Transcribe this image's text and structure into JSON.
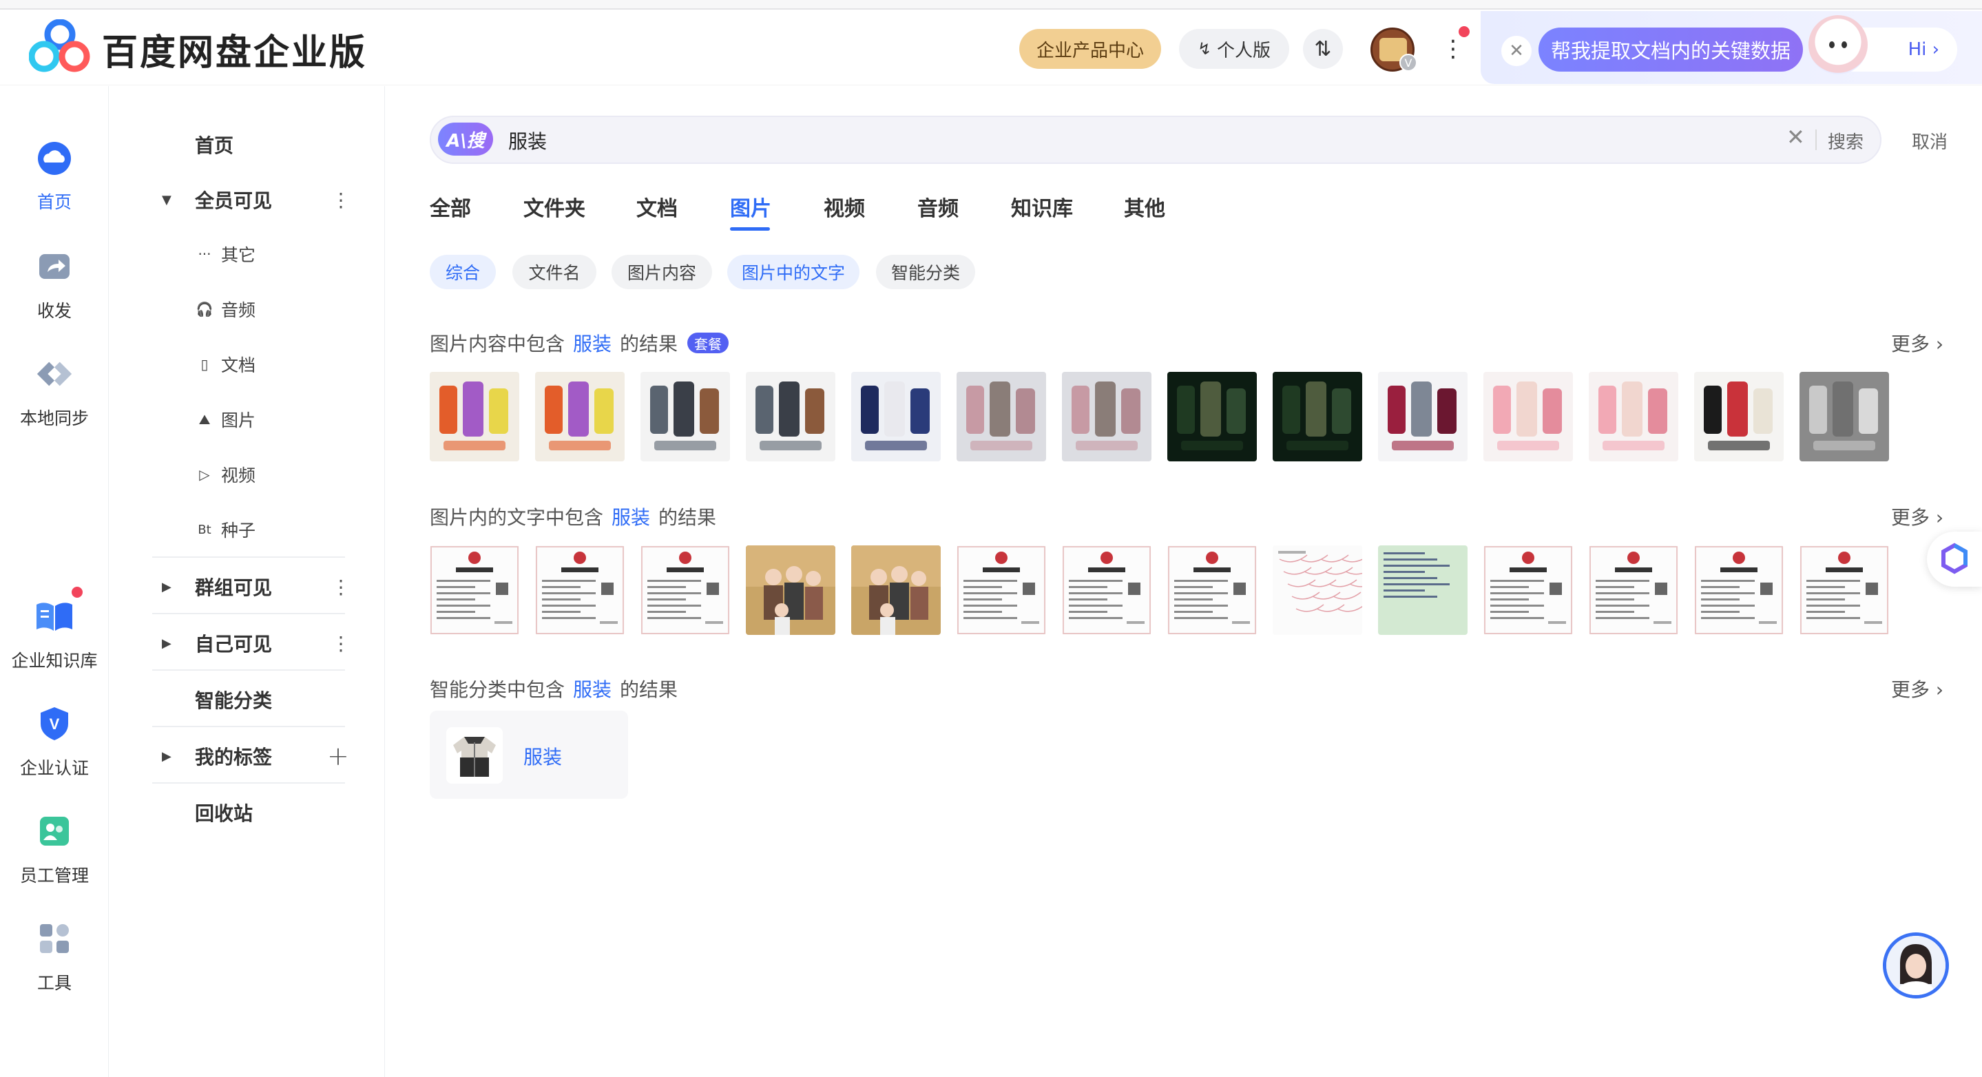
{
  "app": {
    "logo_text": "百度网盘企业版",
    "product_center": "企业产品中心",
    "personal_edition": "个人版",
    "avatar_badge": "V",
    "ai_prompt": "帮我提取文档内的关键数据",
    "hi": "Hi ›"
  },
  "rail": [
    {
      "label": "首页",
      "icon": "cloud-icon",
      "active": true
    },
    {
      "label": "收发",
      "icon": "share-icon",
      "active": false
    },
    {
      "label": "本地同步",
      "icon": "sync-icon",
      "active": false
    },
    {
      "label": "企业知识库",
      "icon": "book-icon",
      "active": false
    },
    {
      "label": "企业认证",
      "icon": "verify-shield-icon",
      "active": false
    },
    {
      "label": "员工管理",
      "icon": "staff-icon",
      "active": false
    },
    {
      "label": "工具",
      "icon": "tools-grid-icon",
      "active": false
    }
  ],
  "nav": {
    "home": "首页",
    "all_visible": "全员可见",
    "sub": [
      {
        "icon": "···",
        "label": "其它"
      },
      {
        "icon": "🎧",
        "label": "音频"
      },
      {
        "icon": "▯",
        "label": "文档"
      },
      {
        "icon": "⛰",
        "label": "图片"
      },
      {
        "icon": "▷",
        "label": "视频"
      },
      {
        "icon": "Bt",
        "label": "种子"
      }
    ],
    "group_visible": "群组可见",
    "self_visible": "自己可见",
    "smart_category": "智能分类",
    "my_tags": "我的标签",
    "recycle_bin": "回收站"
  },
  "search": {
    "ai_badge": "A\\搜",
    "query": "服装",
    "search_btn": "搜索",
    "cancel_btn": "取消"
  },
  "tabs": [
    "全部",
    "文件夹",
    "文档",
    "图片",
    "视频",
    "音频",
    "知识库",
    "其他"
  ],
  "active_tab": "图片",
  "chips": [
    "综合",
    "文件名",
    "图片内容",
    "图片中的文字",
    "智能分类"
  ],
  "active_chips": [
    "综合",
    "图片中的文字"
  ],
  "sections": {
    "content": {
      "prefix": "图片内容中包含",
      "keyword": "服装",
      "suffix": "的结果",
      "tag": "套餐",
      "more": "更多 ›"
    },
    "text": {
      "prefix": "图片内的文字中包含",
      "keyword": "服装",
      "suffix": "的结果",
      "more": "更多 ›"
    },
    "category": {
      "prefix": "智能分类中包含",
      "keyword": "服装",
      "suffix": "的结果",
      "more": "更多 ›",
      "item_label": "服装"
    }
  },
  "colors": {
    "accent": "#2f6cf6",
    "gold": "#f2cf92",
    "ai_gradient_start": "#7b83ff",
    "badge_purple": "#5360f2",
    "red_dot": "#f2445b"
  }
}
